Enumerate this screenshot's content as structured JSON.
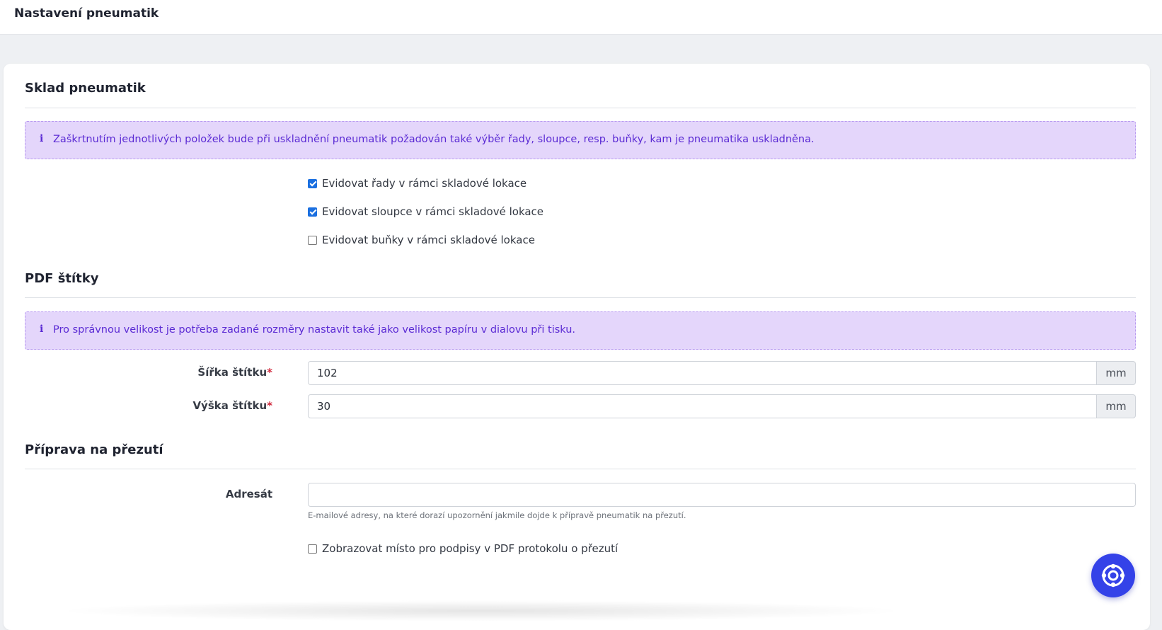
{
  "header": {
    "title": "Nastavení pneumatik"
  },
  "storage": {
    "title": "Sklad pneumatik",
    "info_icon": "info-icon",
    "info": "Zaškrtnutím jednotlivých položek bude při uskladnění pneumatik požadován také výběr řady, sloupce, resp. buňky, kam je pneumatika uskladněna.",
    "options": [
      {
        "label": "Evidovat řady v rámci skladové lokace",
        "checked": true
      },
      {
        "label": "Evidovat sloupce v rámci skladové lokace",
        "checked": true
      },
      {
        "label": "Evidovat buňky v rámci skladové lokace",
        "checked": false
      }
    ]
  },
  "pdf": {
    "title": "PDF štítky",
    "info": "Pro správnou velikost je potřeba zadané rozměry nastavit také jako velikost papíru v dialovu při tisku.",
    "width_label": "Šířka štítku",
    "width_value": "102",
    "height_label": "Výška štítku",
    "height_value": "30",
    "unit": "mm",
    "required_mark": "*"
  },
  "change": {
    "title": "Příprava na přezutí",
    "recipient_label": "Adresát",
    "recipient_value": "",
    "recipient_help": "E-mailové adresy, na které dorazí upozornění jakmile dojde k přípravě pneumatik na přezutí.",
    "signature_label": "Zobrazovat místo pro podpisy v PDF protokolu o přezutí",
    "signature_checked": false
  },
  "fab": {
    "icon": "lifebuoy-icon"
  },
  "colors": {
    "accent": "#3442e8",
    "alert_bg": "#e4d6fb",
    "alert_text": "#5b2bd4",
    "checkbox": "#1a6fe0"
  }
}
